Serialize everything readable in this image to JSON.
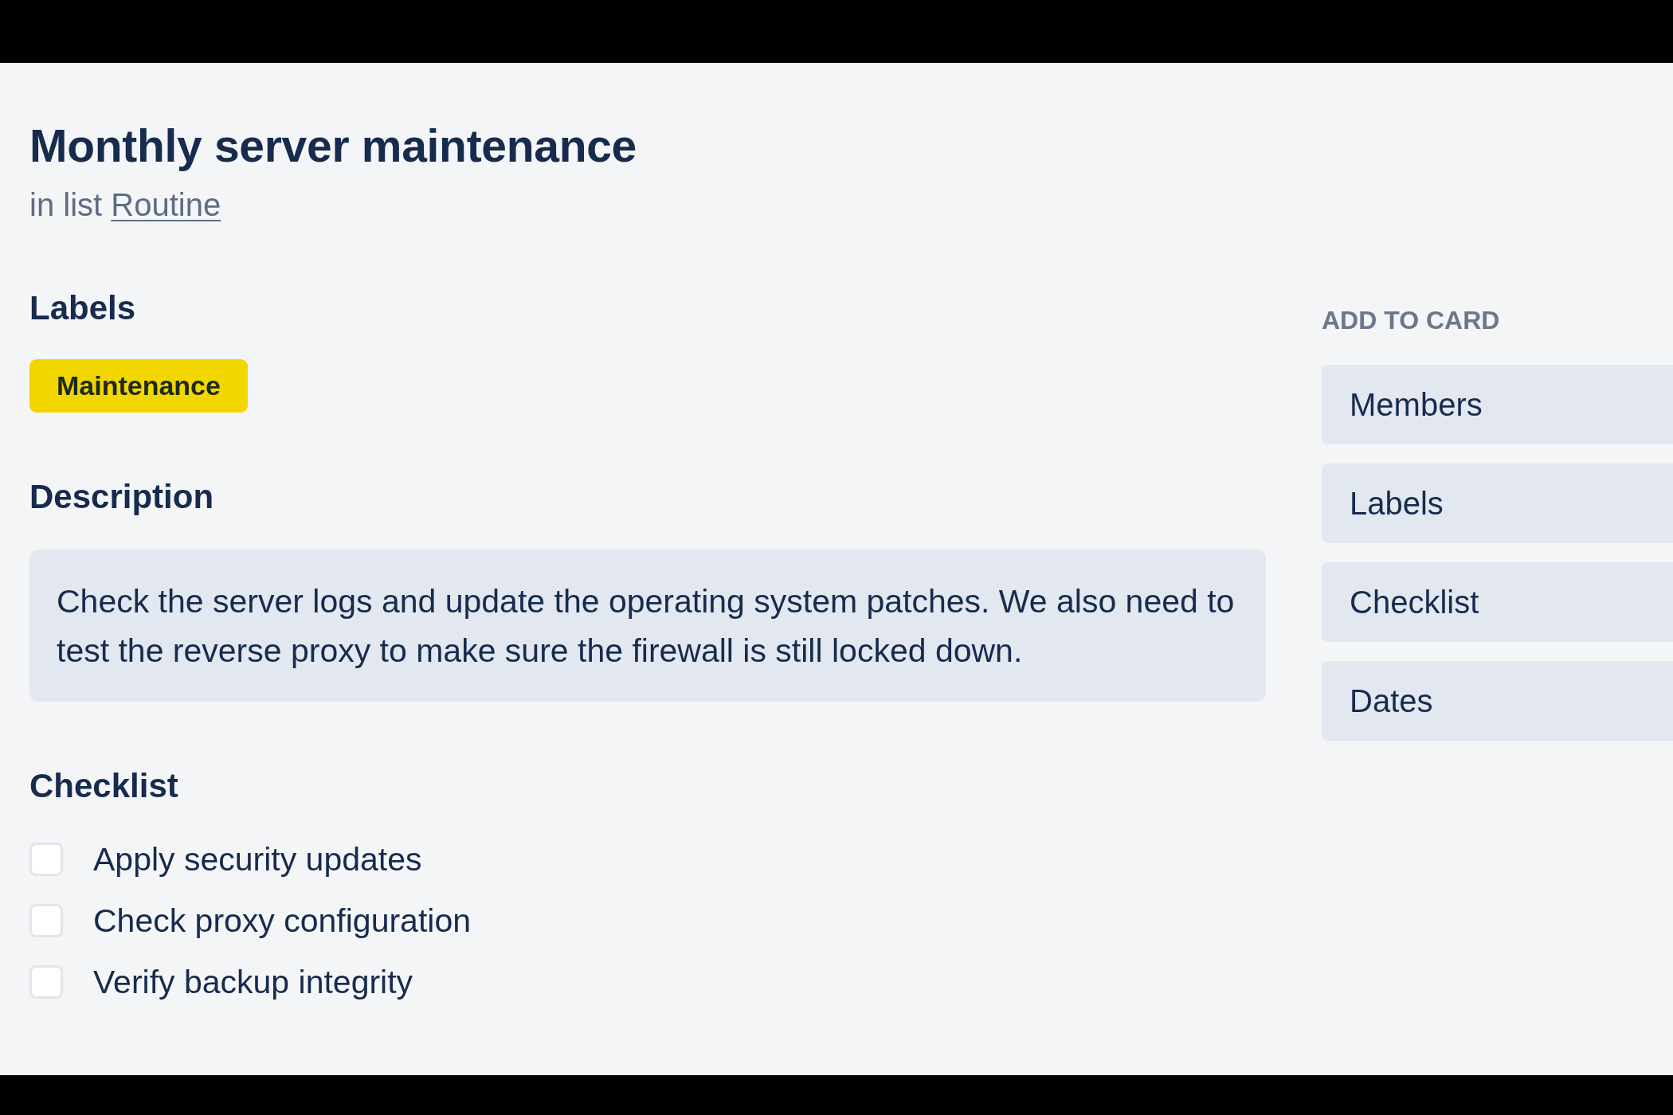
{
  "card": {
    "title": "Monthly server maintenance",
    "list_prefix": "in list",
    "list_name": "Routine"
  },
  "labels": {
    "heading": "Labels",
    "items": [
      {
        "text": "Maintenance",
        "color": "#f2d600"
      }
    ]
  },
  "description": {
    "heading": "Description",
    "text": "Check the server logs and update the operating system patches. We also need to test the reverse proxy to make sure the firewall is still locked down."
  },
  "checklist": {
    "heading": "Checklist",
    "items": [
      {
        "text": "Apply security updates",
        "checked": false
      },
      {
        "text": "Check proxy configuration",
        "checked": false
      },
      {
        "text": "Verify backup integrity",
        "checked": false
      }
    ]
  },
  "sidebar": {
    "heading": "ADD TO CARD",
    "buttons": [
      "Members",
      "Labels",
      "Checklist",
      "Dates"
    ]
  }
}
